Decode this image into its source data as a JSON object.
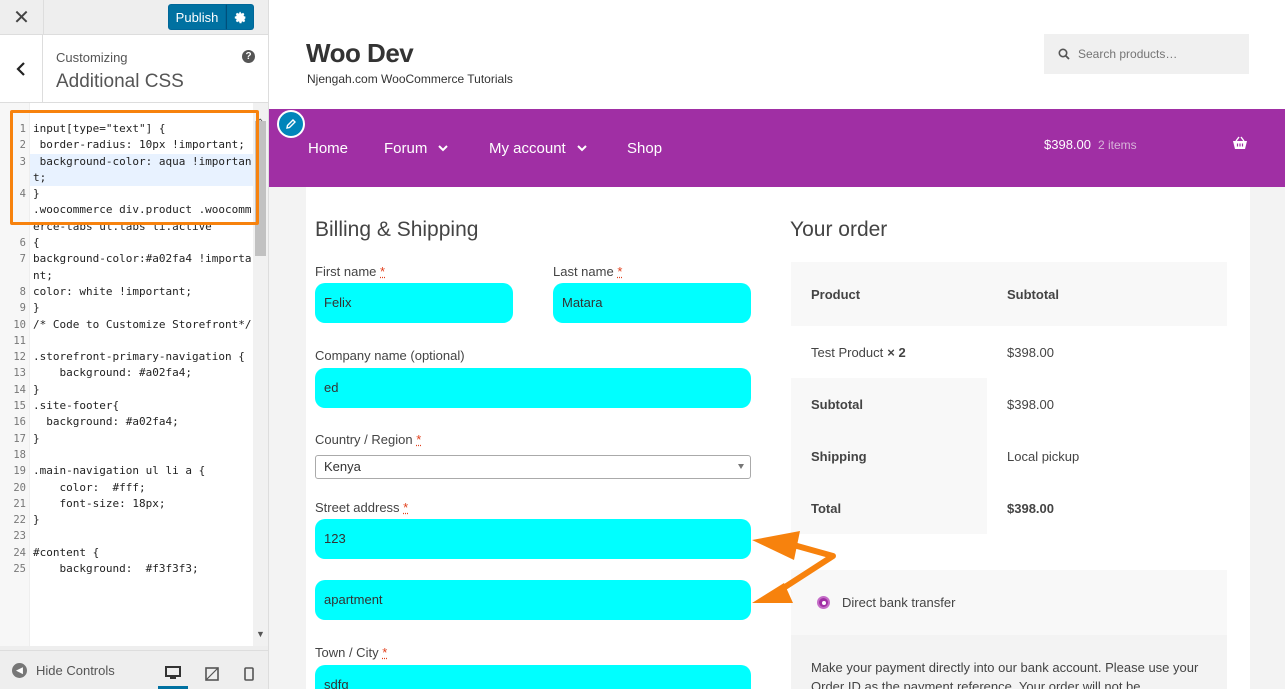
{
  "customizer": {
    "close_icon": "close-icon",
    "publish_label": "Publish",
    "section_sub": "Customizing",
    "section_title": "Additional CSS",
    "help_label": "?",
    "hide_controls_label": "Hide Controls",
    "accent_color": "#0071a1",
    "highlight_color": "#f7820d"
  },
  "css_lines": [
    {
      "n": "1",
      "text": "input[type=\"text\"] {"
    },
    {
      "n": "2",
      "text": " border-radius: 10px !important;"
    },
    {
      "n": "3",
      "text": " background-color: aqua !important;"
    },
    {
      "n": "4",
      "text": "}"
    },
    {
      "n": "",
      "text": ".woocommerce div.product .woocommerce-tabs ul.tabs li.active"
    },
    {
      "n": "6",
      "text": "{"
    },
    {
      "n": "7",
      "text": "background-color:#a02fa4 !important;"
    },
    {
      "n": "8",
      "text": "color: white !important;"
    },
    {
      "n": "9",
      "text": "}"
    },
    {
      "n": "10",
      "text": "/* Code to Customize Storefront*/"
    },
    {
      "n": "11",
      "text": ""
    },
    {
      "n": "12",
      "text": ".storefront-primary-navigation {"
    },
    {
      "n": "13",
      "text": "    background: #a02fa4;"
    },
    {
      "n": "14",
      "text": "}"
    },
    {
      "n": "15",
      "text": ".site-footer{"
    },
    {
      "n": "16",
      "text": "  background: #a02fa4;"
    },
    {
      "n": "17",
      "text": "}"
    },
    {
      "n": "18",
      "text": ""
    },
    {
      "n": "19",
      "text": ".main-navigation ul li a {"
    },
    {
      "n": "20",
      "text": "    color:  #fff;"
    },
    {
      "n": "21",
      "text": "    font-size: 18px;"
    },
    {
      "n": "22",
      "text": "}"
    },
    {
      "n": "23",
      "text": ""
    },
    {
      "n": "24",
      "text": "#content {"
    },
    {
      "n": "25",
      "text": "    background:  #f3f3f3;"
    }
  ],
  "site": {
    "title": "Woo Dev",
    "tagline": "Njengah.com WooCommerce Tutorials",
    "search_placeholder": "Search products…",
    "brand_color": "#a02fa4"
  },
  "nav": {
    "home": "Home",
    "forum": "Forum",
    "account": "My account",
    "shop": "Shop",
    "cart_total": "$398.00",
    "cart_count": "2 items"
  },
  "billing": {
    "title": "Billing & Shipping",
    "first_name_label": "First name",
    "first_name": "Felix",
    "last_name_label": "Last name",
    "last_name": "Matara",
    "company_label": "Company name (optional)",
    "company": "ed",
    "country_label": "Country / Region",
    "country": "Kenya",
    "street_label": "Street address",
    "street": "123",
    "apartment": "apartment",
    "city_label": "Town / City",
    "city": "sdfg",
    "required_mark": "*",
    "input_color": "#00ffff"
  },
  "order": {
    "title": "Your order",
    "col_product": "Product",
    "col_subtotal": "Subtotal",
    "item_name": "Test Product",
    "item_qty": "× 2",
    "item_subtotal": "$398.00",
    "subtotal_label": "Subtotal",
    "subtotal": "$398.00",
    "shipping_label": "Shipping",
    "shipping": "Local pickup",
    "total_label": "Total",
    "total": "$398.00"
  },
  "payment": {
    "method": "Direct bank transfer",
    "description": "Make your payment directly into our bank account. Please use your Order ID as the payment reference. Your order will not be"
  }
}
